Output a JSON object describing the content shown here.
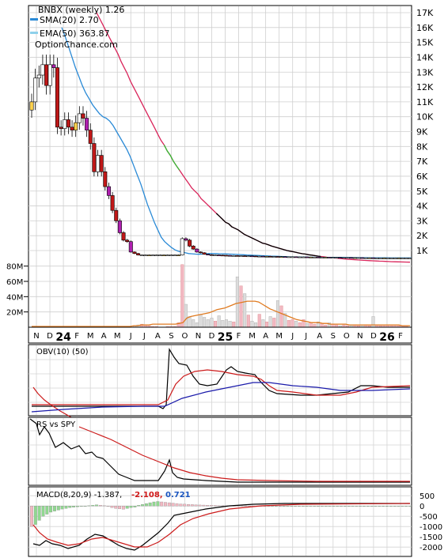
{
  "price_panel": {
    "title": "BNBX (weekly) 1.26",
    "sma_label": "SMA(20) 2.70",
    "ema_label": "EMA(50) 363.87",
    "watermark": "OptionChance.com",
    "sma_color": "#2a8ad6",
    "ema_color": "#8ed0ea"
  },
  "obv_panel": {
    "label": "OBV(10) (50)"
  },
  "rs_panel": {
    "label": "RS vs SPY"
  },
  "macd_panel": {
    "label": "MACD(8,20,9) -1.387,",
    "value_red": "-2.108,",
    "value_blue": "0.721"
  },
  "chart_data": [
    {
      "type": "candlestick",
      "title": "BNBX (weekly) 1.26",
      "y_ticks": [
        "17K",
        "16K",
        "15K",
        "14K",
        "13K",
        "12K",
        "11K",
        "10K",
        "9K",
        "8K",
        "7K",
        "6K",
        "5K",
        "4K",
        "3K",
        "2K",
        "1K"
      ],
      "volume_ticks": [
        "80M",
        "60M",
        "40M",
        "20M"
      ],
      "x_ticks": [
        "N",
        "D",
        "24",
        "F",
        "M",
        "A",
        "M",
        "J",
        "J",
        "A",
        "S",
        "O",
        "N",
        "D",
        "25",
        "F",
        "M",
        "A",
        "M",
        "J",
        "J",
        "A",
        "S",
        "O",
        "N",
        "D",
        "26",
        "F"
      ],
      "ylim": [
        0,
        17500
      ],
      "series": [
        {
          "name": "SMA(20)",
          "color": "#2a8ad6"
        },
        {
          "name": "EMA(50)",
          "color": "#8ed0ea"
        }
      ],
      "close": [
        11000,
        12600,
        12800,
        13500,
        12100,
        13500,
        13300,
        9300,
        9200,
        9800,
        9300,
        9100,
        9600,
        10200,
        9900,
        9100,
        8200,
        6300,
        7400,
        6300,
        5300,
        4700,
        3700,
        3000,
        2200,
        1700,
        1600,
        900,
        800,
        700,
        700,
        700,
        700,
        700,
        700,
        700,
        700,
        700,
        700,
        700,
        700,
        1800,
        1700,
        1300,
        1100,
        900,
        850,
        750,
        720,
        700,
        700,
        690,
        680,
        670,
        660,
        660,
        650,
        650,
        640,
        640,
        630,
        620,
        620,
        610,
        610,
        600,
        600,
        590,
        590,
        580,
        580,
        580,
        570,
        570,
        570,
        560,
        560,
        560,
        550,
        550,
        550,
        540,
        540,
        540,
        530,
        530,
        530,
        520,
        520,
        520,
        510,
        510,
        510,
        500,
        500,
        500,
        500,
        500,
        500,
        500,
        500,
        500,
        500,
        500
      ],
      "volume": [
        0,
        0,
        0,
        0,
        0,
        0,
        0,
        0,
        0,
        0,
        0,
        0,
        0,
        0,
        0,
        0,
        0,
        0,
        0,
        0,
        0,
        0,
        0,
        0,
        0,
        0,
        0,
        0,
        2,
        3,
        4,
        3,
        2,
        1,
        1,
        0,
        0,
        1,
        1,
        1,
        6,
        82,
        30,
        14,
        10,
        6,
        17,
        13,
        10,
        12,
        8,
        15,
        9,
        10,
        8,
        7,
        66,
        54,
        44,
        16,
        8,
        6,
        17,
        10,
        7,
        14,
        12,
        35,
        28,
        18,
        9,
        10,
        8,
        6,
        10,
        5,
        6,
        4,
        7,
        5,
        3,
        6,
        4,
        3,
        2,
        3,
        2,
        2,
        3,
        2,
        2,
        3,
        2,
        14,
        3,
        2,
        2,
        2,
        2,
        2,
        2,
        2,
        2
      ],
      "volume_ylim": [
        0,
        90
      ],
      "trendline_segments": [
        {
          "color": "#d9245a"
        },
        {
          "color": "#d9245a"
        },
        {
          "color": "#33bb33"
        },
        {
          "color": "#d9245a"
        },
        {
          "color": "#000000"
        }
      ],
      "ema_long": [
        17000,
        16600,
        16200,
        15800,
        15400,
        15000,
        14600,
        14200,
        13700,
        13300,
        12900,
        12400,
        12000,
        11600,
        11200,
        10800,
        10400,
        10000,
        9600,
        9200,
        8800,
        8400,
        8100,
        7700,
        7400,
        7000,
        6700,
        6400,
        6100,
        5800,
        5500,
        5200,
        5000,
        4800,
        4500,
        4300,
        4100,
        3900,
        3700,
        3500,
        3300,
        3100,
        2900,
        2800,
        2600,
        2500,
        2400,
        2250,
        2100,
        2000,
        1900,
        1800,
        1700,
        1600,
        1500,
        1450,
        1380,
        1300,
        1240,
        1180,
        1120,
        1060,
        1000,
        960,
        920,
        870,
        830,
        790,
        760,
        720,
        690,
        660,
        630,
        600,
        580,
        550,
        530,
        510,
        490,
        470,
        450,
        430,
        410,
        400,
        385,
        370,
        355,
        340,
        330,
        320,
        310,
        300,
        290,
        280,
        270,
        260,
        250,
        245,
        240,
        235,
        230,
        225,
        220
      ],
      "sma_mid": [
        16000,
        15400,
        14700,
        14000,
        13300,
        12700,
        12100,
        11600,
        11200,
        10800,
        10500,
        10200,
        10000,
        9900,
        9700,
        9400,
        9000,
        8600,
        8200,
        7800,
        7300,
        6700,
        6100,
        5500,
        4800,
        4100,
        3500,
        2900,
        2400,
        1900,
        1600,
        1400,
        1200,
        1050,
        950,
        900,
        850,
        800,
        780,
        760,
        750,
        760,
        780,
        800,
        800,
        800,
        790,
        780,
        770,
        760,
        750,
        740,
        730,
        720,
        700,
        690,
        680,
        670,
        660,
        650,
        640,
        630,
        620,
        610,
        600,
        590,
        580,
        575,
        570,
        565,
        560,
        560,
        555,
        555,
        550,
        550,
        545,
        545,
        540,
        540,
        540,
        535,
        535,
        530,
        530,
        525,
        525,
        520,
        520,
        520,
        515,
        515,
        510,
        510,
        510,
        510,
        505,
        505,
        505,
        505,
        505,
        505,
        505
      ]
    },
    {
      "type": "line",
      "title": "OBV(10) (50)",
      "series": [
        {
          "name": "OBV",
          "color": "#000000"
        },
        {
          "name": "(10)",
          "color": "#cc1a1a"
        },
        {
          "name": "(50)",
          "color": "#1a1aaa"
        }
      ]
    },
    {
      "type": "line",
      "title": "RS vs SPY",
      "series": [
        {
          "name": "RS",
          "color": "#000000"
        },
        {
          "name": "MA",
          "color": "#cc1a1a"
        }
      ]
    },
    {
      "type": "bar",
      "title": "MACD(8,20,9)",
      "y_ticks": [
        "500",
        "0",
        "-500",
        "-1000",
        "-1500",
        "-2000"
      ],
      "ylim": [
        -2300,
        700
      ],
      "series": [
        {
          "name": "MACD",
          "color": "#000000"
        },
        {
          "name": "Signal",
          "color": "#cc1a1a"
        },
        {
          "name": "Histogram",
          "color": "#90d890"
        }
      ]
    }
  ]
}
